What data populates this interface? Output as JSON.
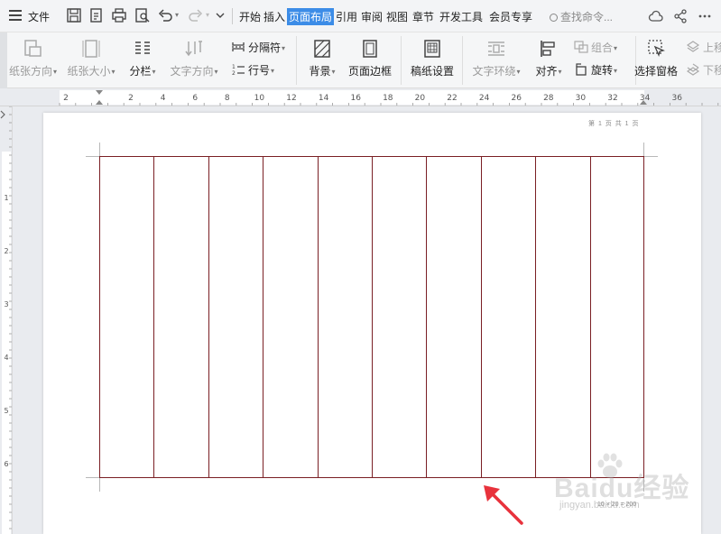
{
  "menu": {
    "file_label": "文件",
    "tabs": [
      "开始",
      "插入",
      "页面布局",
      "引用",
      "审阅",
      "视图",
      "章节",
      "开发工具",
      "会员专享"
    ],
    "active_tab": "页面布局",
    "search_placeholder": "查找命令..."
  },
  "ribbon": {
    "paper_orientation": "纸张方向",
    "paper_size": "纸张大小",
    "columns": "分栏",
    "text_direction": "文字方向",
    "separator": "分隔符",
    "line_number": "行号",
    "background": "背景",
    "page_border": "页面边框",
    "manuscript_settings": "稿纸设置",
    "text_wrap": "文字环绕",
    "align": "对齐",
    "group": "组合",
    "rotate": "旋转",
    "selection_pane": "选择窗格",
    "bring_forward": "上移",
    "send_backward": "下移"
  },
  "ruler": {
    "numbers": [
      "2",
      "2",
      "4",
      "6",
      "8",
      "10",
      "12",
      "14",
      "16",
      "18",
      "20",
      "22",
      "24",
      "26",
      "28",
      "30",
      "32",
      "34",
      "36"
    ],
    "vertical_numbers": [
      "1",
      "2",
      "3",
      "4",
      "5",
      "6"
    ]
  },
  "document": {
    "header_text": "第 1 页 共 1 页",
    "footer_text": "10 × 20 = 200",
    "grid_columns": 10,
    "grid_color": "#7a1f24"
  },
  "watermark": {
    "main": "Baidu经验",
    "sub": "jingyan.baidu.com"
  },
  "colors": {
    "accent": "#3c8ce7",
    "arrow": "#e8323c"
  }
}
